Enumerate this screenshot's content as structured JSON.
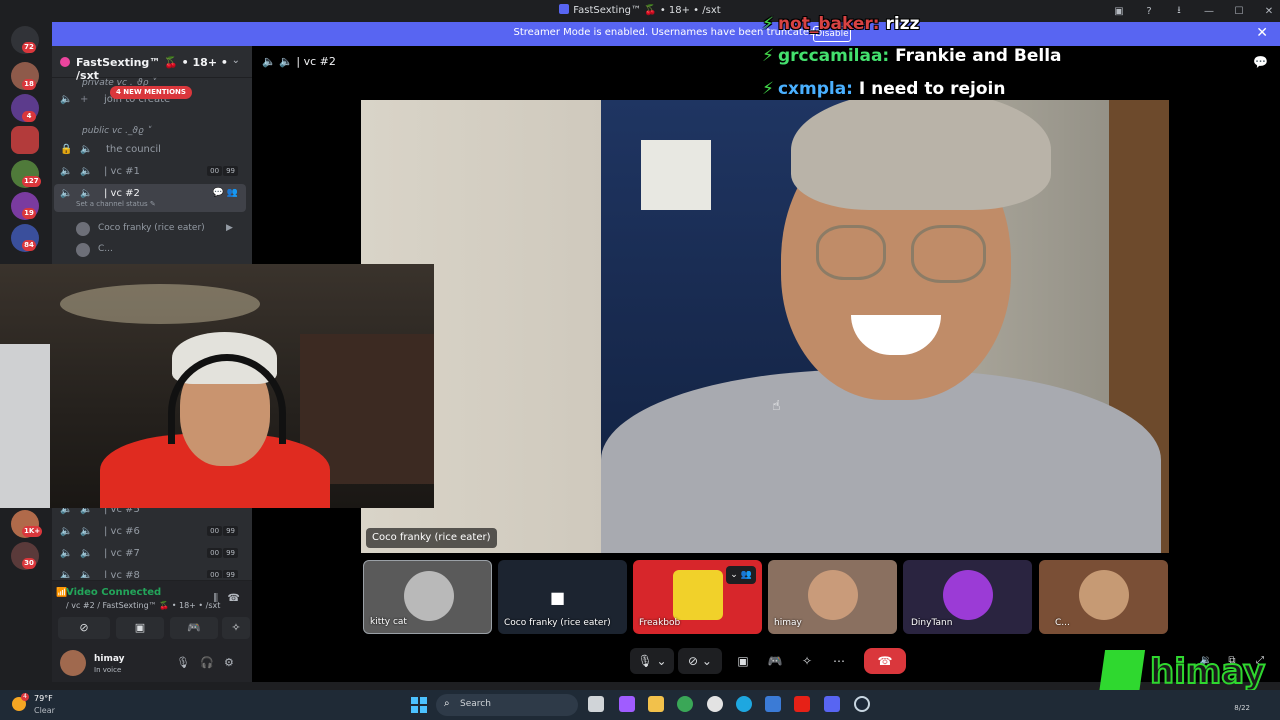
{
  "window": {
    "title": "FastSexting™ 🍒 • 18+ • /sxt"
  },
  "banner": {
    "message": "Streamer Mode is enabled. Usernames have been truncated.",
    "disable_label": "Disable"
  },
  "guild_badges": [
    "72",
    "18",
    "4",
    "127",
    "19",
    "84",
    "1K+",
    "30"
  ],
  "server": {
    "name": "FastSexting™ 🍒 • 18+ • /sxt"
  },
  "channels": {
    "category_private": "private vc ._ϑϱ ˅",
    "join_to_create": "join to create",
    "mentions_badge": "4 NEW MENTIONS",
    "category_public": "public vc ._ϑϱ ˅",
    "items": [
      {
        "name": "the council"
      },
      {
        "name": "| vc #1",
        "count_a": "00",
        "count_b": "99"
      },
      {
        "name": "| vc #2",
        "status": "Set a channel status ✎"
      },
      {
        "name": "| vc #5"
      },
      {
        "name": "| vc #6",
        "count_a": "00",
        "count_b": "99"
      },
      {
        "name": "| vc #7",
        "count_a": "00",
        "count_b": "99"
      },
      {
        "name": "| vc #8",
        "count_a": "00",
        "count_b": "99"
      }
    ],
    "voice_users": [
      "Coco franky (rice eater)",
      "C..."
    ]
  },
  "voice_panel": {
    "status": "Video Connected",
    "location": "/ vc #2 / FastSexting™ 🍒 • 18+ • /sxt"
  },
  "user_panel": {
    "name": "himay",
    "status": "In voice"
  },
  "main": {
    "header": "| vc #2",
    "video_label": "Coco franky (rice eater)"
  },
  "stream_chat": [
    {
      "user": "not_baker:",
      "text": "rizz"
    },
    {
      "user": "grccamilaa:",
      "text": "Frankie and Bella"
    },
    {
      "user": "cxmpla:",
      "text": "I need to rejoin"
    }
  ],
  "tiles": [
    {
      "name": "kitty cat"
    },
    {
      "name": "Coco franky (rice eater)"
    },
    {
      "name": "Freakbob"
    },
    {
      "name": "himay"
    },
    {
      "name": "DinyTann"
    },
    {
      "name": "C..."
    }
  ],
  "brand": {
    "text": "himay"
  },
  "taskbar": {
    "temp": "79°F",
    "condition": "Clear",
    "weather_badge": "4",
    "search_placeholder": "Search",
    "date": "8/22"
  }
}
